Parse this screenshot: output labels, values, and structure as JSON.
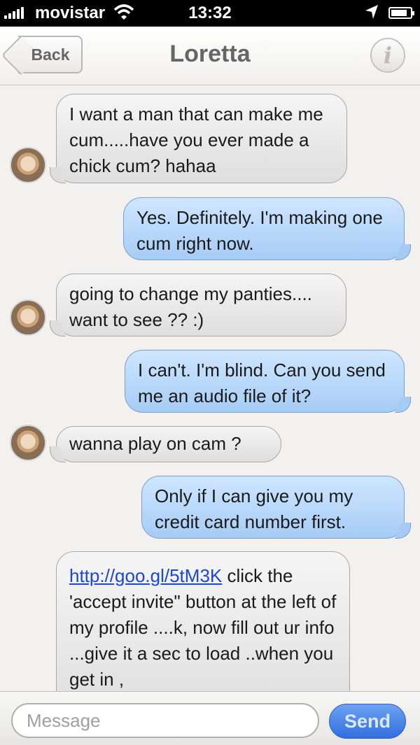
{
  "status_bar": {
    "carrier": "movistar",
    "time": "13:32",
    "icons": [
      "signal-icon",
      "wifi-icon",
      "location-arrow-icon",
      "battery-icon"
    ]
  },
  "nav": {
    "back_label": "Back",
    "title": "Loretta",
    "info_label": "i"
  },
  "messages": [
    {
      "from": "contact",
      "text": "I want a man that can make me cum.....have you ever made a chick cum? hahaa"
    },
    {
      "from": "me",
      "text": "Yes. Definitely. I'm making one cum right now."
    },
    {
      "from": "contact",
      "text": "going to change my panties.... want to see ?? :)"
    },
    {
      "from": "me",
      "text": "I can't. I'm blind. Can you send me an audio file of it?"
    },
    {
      "from": "contact",
      "text": "wanna play on cam ?"
    },
    {
      "from": "me",
      "text": "Only if I can give you my credit card number first."
    },
    {
      "from": "contact",
      "link": "http://goo.gl/5tM3K",
      "text": " click the 'accept invite\" button at the left of my profile ....k, now fill out ur info ...give it a sec to load ..when you get in ,"
    }
  ],
  "composer": {
    "placeholder": "Message",
    "send_label": "Send"
  },
  "colors": {
    "incoming_bubble": "#dedede",
    "outgoing_bubble": "#a6ccf5",
    "send_button": "#2f6ede",
    "link": "#1a47d6"
  }
}
